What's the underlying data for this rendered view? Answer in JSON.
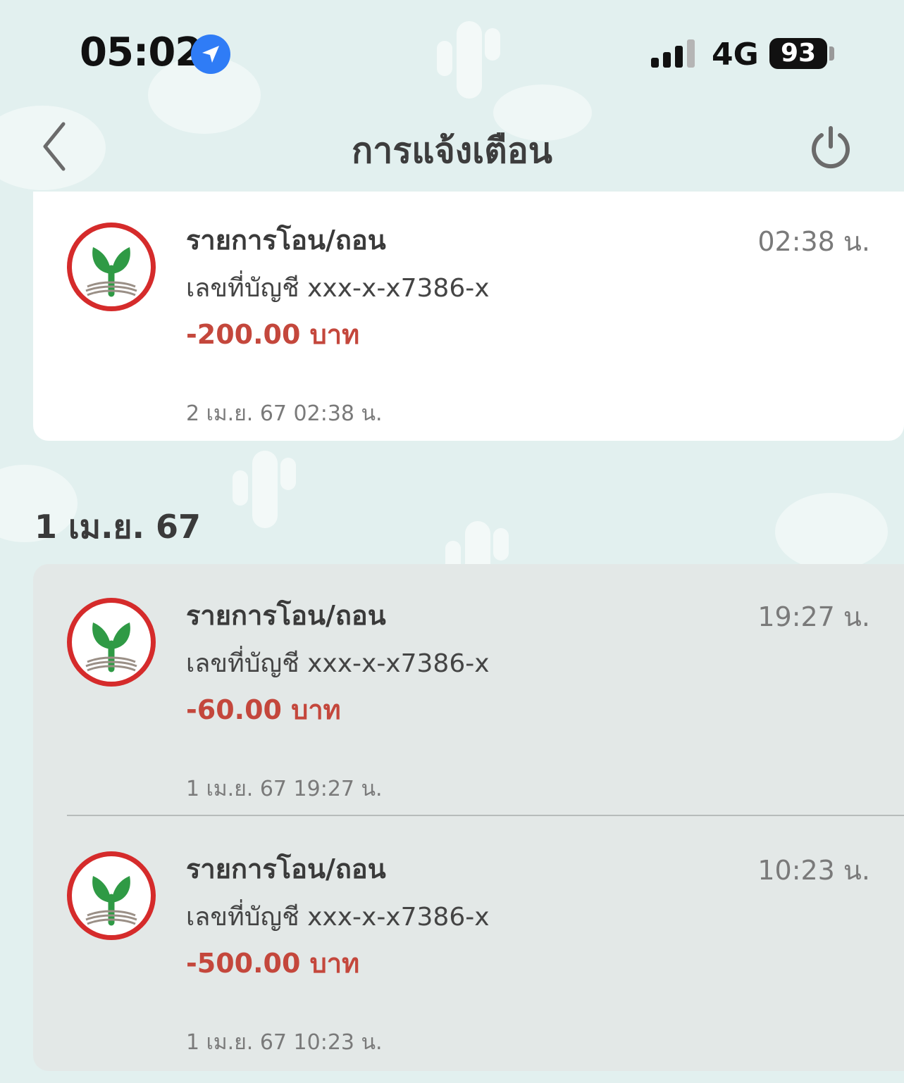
{
  "status_bar": {
    "time": "05:02",
    "network": "4G",
    "battery": "93",
    "location_icon": "location-arrow-icon",
    "signal_icon": "cellular-signal-icon"
  },
  "header": {
    "title": "การแจ้งเตือน",
    "back_icon": "chevron-left-icon",
    "power_icon": "power-icon"
  },
  "colors": {
    "background": "#e2f0ef",
    "amount": "#c4473c",
    "logo_ring": "#d52b2b",
    "logo_leaf": "#2f9a45"
  },
  "notifications_top": [
    {
      "title": "รายการโอน/ถอน",
      "time": "02:38 น.",
      "account": "เลขที่บัญชี xxx-x-x7386-x",
      "amount": "-200.00 บาท",
      "date": "2 เม.ย. 67 02:38 น."
    }
  ],
  "section": {
    "date_label": "1 เม.ย. 67"
  },
  "notifications_section": [
    {
      "title": "รายการโอน/ถอน",
      "time": "19:27 น.",
      "account": "เลขที่บัญชี xxx-x-x7386-x",
      "amount": "-60.00 บาท",
      "date": "1 เม.ย. 67 19:27 น."
    },
    {
      "title": "รายการโอน/ถอน",
      "time": "10:23 น.",
      "account": "เลขที่บัญชี xxx-x-x7386-x",
      "amount": "-500.00 บาท",
      "date": "1 เม.ย. 67 10:23 น."
    }
  ]
}
